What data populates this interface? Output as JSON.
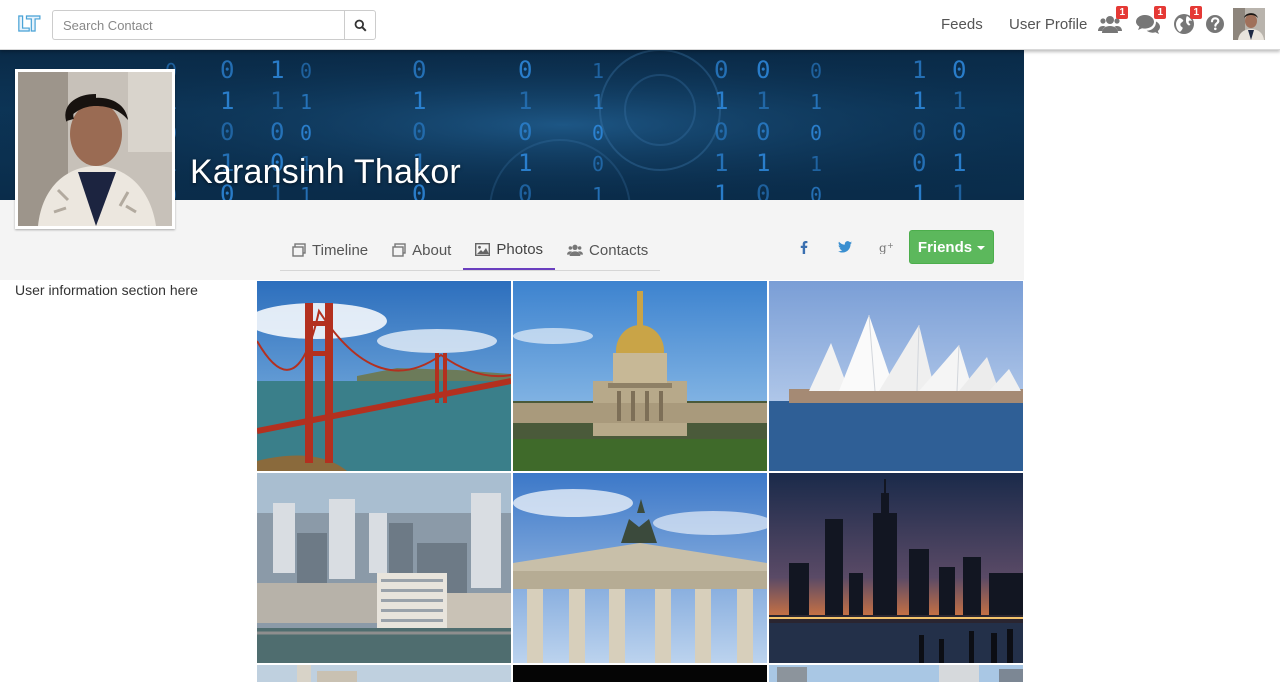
{
  "navbar": {
    "logo_text": "LT",
    "search_placeholder": "Search Contact",
    "links": {
      "feeds": "Feeds",
      "user_profile": "User Profile"
    },
    "badges": {
      "friend_requests": "1",
      "messages": "1",
      "notifications": "1"
    },
    "icons": [
      "users-icon",
      "comments-icon",
      "globe-icon",
      "question-icon"
    ]
  },
  "profile": {
    "name": "Karansinh Thakor",
    "cover_digits": [
      "0",
      "1",
      "0",
      "1",
      "0",
      "0",
      "1",
      "0",
      "1",
      "0",
      "1",
      "1",
      "0",
      "0",
      "1",
      "0",
      "1",
      "0",
      "1",
      "1"
    ]
  },
  "tabs": [
    {
      "label": "Timeline",
      "icon": "timeline-icon"
    },
    {
      "label": "About",
      "icon": "about-icon"
    },
    {
      "label": "Photos",
      "icon": "photo-icon",
      "active": true
    },
    {
      "label": "Contacts",
      "icon": "users-icon"
    }
  ],
  "social": {
    "facebook": "f",
    "twitter": "twitter",
    "google_plus": "g+"
  },
  "friends_button": "Friends",
  "sidebar": {
    "user_info": "User information section here"
  },
  "colors": {
    "accent": "#6a3fbf",
    "success": "#5cb85c",
    "badge": "#e53935",
    "cover": "#0c3557"
  }
}
